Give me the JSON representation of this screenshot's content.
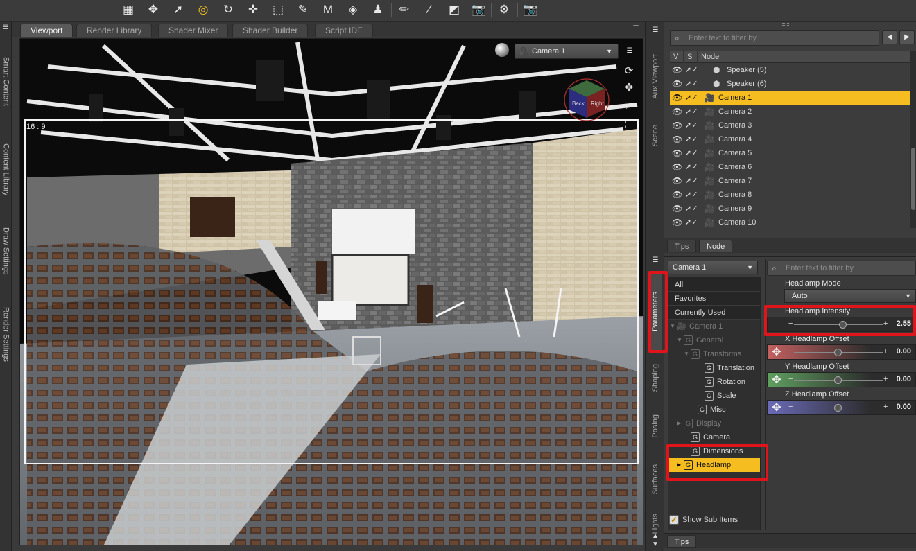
{
  "toolbar": {
    "tools": [
      {
        "name": "universal-grid-tool",
        "glyph": "▦"
      },
      {
        "name": "universal-tool",
        "glyph": "✥"
      },
      {
        "name": "node-selection-tool",
        "glyph": "➚"
      },
      {
        "name": "spot-render-tool",
        "glyph": "◎"
      },
      {
        "name": "rotate-tool",
        "glyph": "↻"
      },
      {
        "name": "translate-tool",
        "glyph": "✛"
      },
      {
        "name": "scale-tool",
        "glyph": "⬚"
      },
      {
        "name": "joint-editor-tool",
        "glyph": "✎"
      },
      {
        "name": "morph-tool",
        "glyph": "M"
      },
      {
        "name": "surface-selection-tool",
        "glyph": "◈"
      },
      {
        "name": "active-pose-tool",
        "glyph": "♟"
      },
      {
        "name": "node-weight-brush-tool",
        "glyph": "✏"
      },
      {
        "name": "geometry-editor-tool",
        "glyph": "⁄"
      },
      {
        "name": "region-navigator-tool",
        "glyph": "◩"
      },
      {
        "name": "camera-tool",
        "glyph": "📷"
      },
      {
        "name": "pose-tool",
        "glyph": "⚙"
      },
      {
        "name": "render-tool",
        "glyph": "📷"
      }
    ]
  },
  "left_strip": {
    "tabs": [
      "Smart Content",
      "Content Library",
      "Draw Settings",
      "Render Settings"
    ]
  },
  "viewport_tabs": [
    "Viewport",
    "Render Library",
    "Shader Mixer",
    "Shader Builder",
    "Script IDE"
  ],
  "viewport": {
    "aspect_label": "16 : 9",
    "camera_select": "Camera 1",
    "viewcube_faces": [
      "Back",
      "Right"
    ]
  },
  "middle_strip": {
    "top_tabs": [
      "Aux Viewport",
      "Scene"
    ],
    "bottom_tabs": [
      "Parameters",
      "Shaping",
      "Posing",
      "Surfaces",
      "Lights"
    ]
  },
  "scene_pane": {
    "filter_placeholder": "Enter text to filter by...",
    "columns": [
      "V",
      "S",
      "Node"
    ],
    "nodes": [
      {
        "label": "Speaker (5)",
        "icon": "object-icon",
        "indent": true,
        "selected": false
      },
      {
        "label": "Speaker (6)",
        "icon": "object-icon",
        "indent": true,
        "selected": false
      },
      {
        "label": "Camera 1",
        "icon": "camera-icon",
        "indent": false,
        "selected": true
      },
      {
        "label": "Camera 2",
        "icon": "camera-icon",
        "indent": false,
        "selected": false
      },
      {
        "label": "Camera 3",
        "icon": "camera-icon",
        "indent": false,
        "selected": false
      },
      {
        "label": "Camera 4",
        "icon": "camera-icon",
        "indent": false,
        "selected": false
      },
      {
        "label": "Camera 5",
        "icon": "camera-icon",
        "indent": false,
        "selected": false
      },
      {
        "label": "Camera 6",
        "icon": "camera-icon",
        "indent": false,
        "selected": false
      },
      {
        "label": "Camera 7",
        "icon": "camera-icon",
        "indent": false,
        "selected": false
      },
      {
        "label": "Camera 8",
        "icon": "camera-icon",
        "indent": false,
        "selected": false
      },
      {
        "label": "Camera 9",
        "icon": "camera-icon",
        "indent": false,
        "selected": false
      },
      {
        "label": "Camera 10",
        "icon": "camera-icon",
        "indent": false,
        "selected": false
      }
    ],
    "bottom_tabs": [
      "Tips",
      "Node"
    ]
  },
  "parameters_pane": {
    "node_select": "Camera 1",
    "filter_placeholder": "Enter text to filter by...",
    "quick_groups": [
      "All",
      "Favorites",
      "Currently Used"
    ],
    "tree": [
      {
        "label": "Camera 1",
        "kind": "node",
        "dim": true,
        "expanded": true
      },
      {
        "label": "General",
        "kind": "group",
        "dim": true,
        "expanded": true
      },
      {
        "label": "Transforms",
        "kind": "group",
        "dim": true,
        "expanded": true
      },
      {
        "label": "Translation",
        "kind": "group",
        "dim": false
      },
      {
        "label": "Rotation",
        "kind": "group",
        "dim": false
      },
      {
        "label": "Scale",
        "kind": "group",
        "dim": false
      },
      {
        "label": "Misc",
        "kind": "group",
        "dim": false
      },
      {
        "label": "Display",
        "kind": "group",
        "dim": true,
        "collapsed": true
      },
      {
        "label": "Camera",
        "kind": "group",
        "dim": false
      },
      {
        "label": "Dimensions",
        "kind": "group",
        "dim": false
      },
      {
        "label": "Headlamp",
        "kind": "group",
        "dim": false,
        "selected": true,
        "collapsed": true
      }
    ],
    "show_sub_items": "Show Sub Items",
    "properties": {
      "mode": {
        "label": "Headlamp Mode",
        "value": "Auto"
      },
      "intensity": {
        "label": "Headlamp Intensity",
        "value": "2.55",
        "level": 0.55
      },
      "x_offset": {
        "label": "X Headlamp Offset",
        "value": "0.00",
        "color": "#c46060"
      },
      "y_offset": {
        "label": "Y Headlamp Offset",
        "value": "0.00",
        "color": "#5fa05f"
      },
      "z_offset": {
        "label": "Z Headlamp Offset",
        "value": "0.00",
        "color": "#6a6ab8"
      }
    },
    "bottom_tab": "Tips"
  },
  "colors": {
    "selection": "#f5bd1f",
    "highlight_box": "#e0141b"
  }
}
